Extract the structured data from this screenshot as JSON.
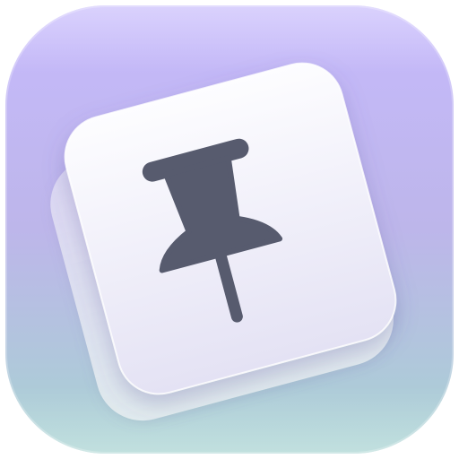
{
  "app_icon": {
    "name": "pushpin-app-icon",
    "colors": {
      "bg_top": "#c5b8fb",
      "bg_mid": "#bdb4ea",
      "bg_bottom": "#a9d0d0",
      "back_card": "#e7e6f3",
      "card_top": "#fbfbfe",
      "card_bottom": "#e7e5f5",
      "pin": "#575b6e"
    },
    "icons": [
      "app-icon-background",
      "back-card",
      "front-card",
      "pushpin-icon"
    ]
  }
}
